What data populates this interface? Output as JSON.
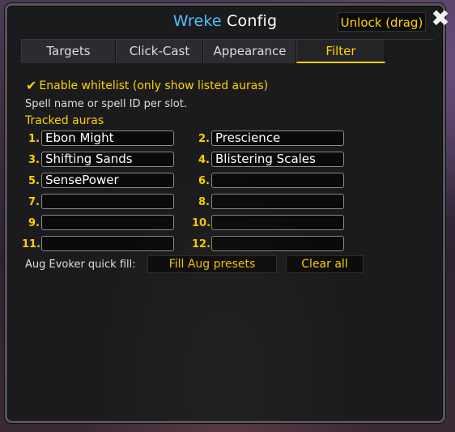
{
  "window": {
    "title_accent": "Wreke",
    "title_rest": " Config",
    "unlock_label": "Unlock (drag)",
    "close_glyph": "✖"
  },
  "tabs": [
    {
      "label": "Targets",
      "active": false
    },
    {
      "label": "Click-Cast",
      "active": false
    },
    {
      "label": "Appearance",
      "active": false
    },
    {
      "label": "Filter",
      "active": true
    }
  ],
  "filter": {
    "whitelist_label": "Enable whitelist (only show listed auras)",
    "whitelist_checked": true,
    "hint": "Spell name or spell ID per slot.",
    "tracked_heading": "Tracked auras",
    "slots": [
      {
        "num": "1.",
        "value": "Ebon Might"
      },
      {
        "num": "2.",
        "value": "Prescience"
      },
      {
        "num": "3.",
        "value": "Shifting Sands"
      },
      {
        "num": "4.",
        "value": "Blistering Scales"
      },
      {
        "num": "5.",
        "value": "SensePower"
      },
      {
        "num": "6.",
        "value": ""
      },
      {
        "num": "7.",
        "value": ""
      },
      {
        "num": "8.",
        "value": ""
      },
      {
        "num": "9.",
        "value": ""
      },
      {
        "num": "10.",
        "value": ""
      },
      {
        "num": "11.",
        "value": ""
      },
      {
        "num": "12.",
        "value": ""
      }
    ],
    "quickfill_label": "Aug Evoker quick fill:",
    "fill_button": "Fill Aug presets",
    "clear_button": "Clear all"
  },
  "colors": {
    "accent_gold": "#ffd100",
    "title_blue": "#4fc0ff",
    "panel_bg": "#1b1b1e"
  }
}
